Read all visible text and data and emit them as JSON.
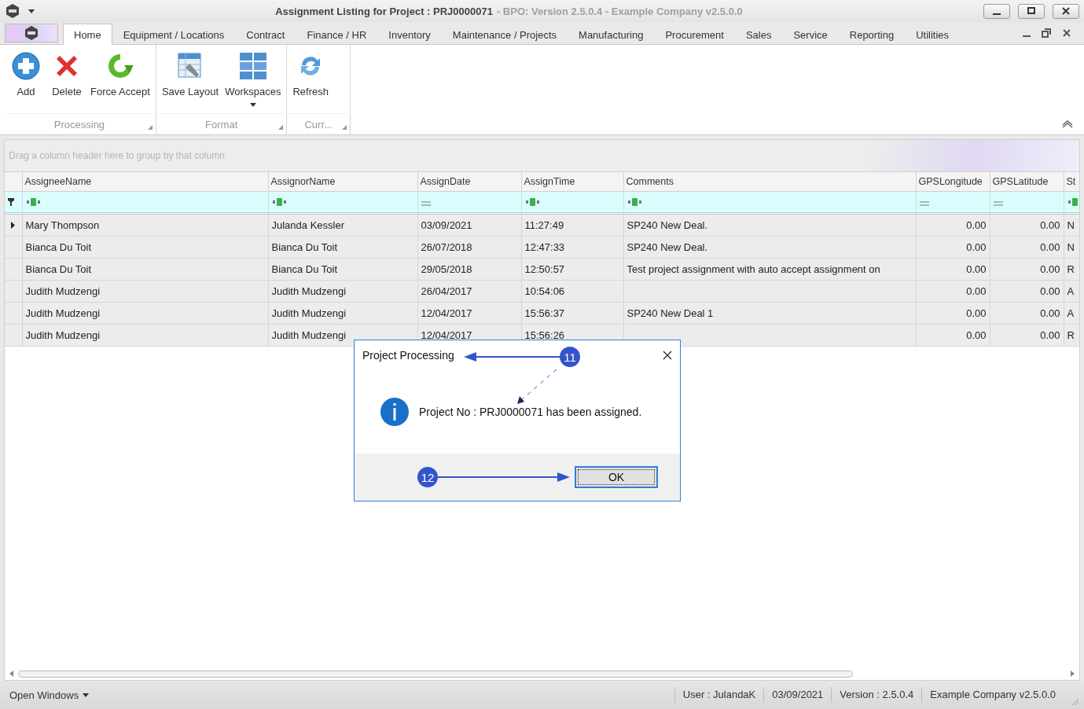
{
  "window": {
    "title": "Assignment Listing for Project : PRJ0000071",
    "subtitle": "- BPO: Version 2.5.0.4 - Example Company v2.5.0.0"
  },
  "ribbon_tabs": [
    {
      "label": "Home",
      "selected": true
    },
    {
      "label": "Equipment / Locations",
      "selected": false
    },
    {
      "label": "Contract",
      "selected": false
    },
    {
      "label": "Finance / HR",
      "selected": false
    },
    {
      "label": "Inventory",
      "selected": false
    },
    {
      "label": "Maintenance / Projects",
      "selected": false
    },
    {
      "label": "Manufacturing",
      "selected": false
    },
    {
      "label": "Procurement",
      "selected": false
    },
    {
      "label": "Sales",
      "selected": false
    },
    {
      "label": "Service",
      "selected": false
    },
    {
      "label": "Reporting",
      "selected": false
    },
    {
      "label": "Utilities",
      "selected": false
    }
  ],
  "ribbon_groups": [
    {
      "label": "Processing",
      "buttons": [
        {
          "label": "Add",
          "kind": "add"
        },
        {
          "label": "Delete",
          "kind": "delete"
        },
        {
          "label": "Force Accept",
          "kind": "accept"
        }
      ]
    },
    {
      "label": "Format",
      "buttons": [
        {
          "label": "Save Layout",
          "kind": "layout"
        },
        {
          "label": "Workspaces",
          "kind": "workspaces",
          "dropdown": true
        }
      ]
    },
    {
      "label": "Curr...",
      "buttons": [
        {
          "label": "Refresh",
          "kind": "refresh"
        }
      ]
    }
  ],
  "group_panel": {
    "placeholder": "Drag a column header here to group by that column"
  },
  "table": {
    "columns": [
      {
        "label": "AssigneeName",
        "kind": "text"
      },
      {
        "label": "AssignorName",
        "kind": "text"
      },
      {
        "label": "AssignDate",
        "kind": "date"
      },
      {
        "label": "AssignTime",
        "kind": "text"
      },
      {
        "label": "Comments",
        "kind": "text"
      },
      {
        "label": "GPSLongitude",
        "kind": "number"
      },
      {
        "label": "GPSLatitude",
        "kind": "number"
      },
      {
        "label": "St",
        "kind": "text"
      }
    ],
    "rows": [
      {
        "selected": true,
        "cells": [
          "Mary Thompson",
          "Julanda Kessler",
          "03/09/2021",
          "11:27:49",
          "SP240 New Deal.",
          "0.00",
          "0.00",
          "N"
        ]
      },
      {
        "selected": false,
        "cells": [
          "Bianca Du Toit",
          "Bianca Du Toit",
          "26/07/2018",
          "12:47:33",
          "SP240 New Deal.",
          "0.00",
          "0.00",
          "N"
        ]
      },
      {
        "selected": false,
        "cells": [
          "Bianca Du Toit",
          "Bianca Du Toit",
          "29/05/2018",
          "12:50:57",
          "Test project assignment with auto accept assignment on",
          "0.00",
          "0.00",
          "R"
        ]
      },
      {
        "selected": false,
        "cells": [
          "Judith Mudzengi",
          "Judith Mudzengi",
          "26/04/2017",
          "10:54:06",
          "",
          "0.00",
          "0.00",
          "A"
        ]
      },
      {
        "selected": false,
        "cells": [
          "Judith Mudzengi",
          "Judith Mudzengi",
          "12/04/2017",
          "15:56:37",
          "SP240 New Deal 1",
          "0.00",
          "0.00",
          "A"
        ]
      },
      {
        "selected": false,
        "cells": [
          "Judith Mudzengi",
          "Judith Mudzengi",
          "12/04/2017",
          "15:56:26",
          "",
          "0.00",
          "0.00",
          "R"
        ]
      }
    ]
  },
  "dialog": {
    "title": "Project Processing",
    "message": "Project No : PRJ0000071 has been assigned.",
    "button": "OK"
  },
  "callouts": [
    "11",
    "12"
  ],
  "status_bar": {
    "open_windows": "Open Windows",
    "items": [
      "User : JulandaK",
      "03/09/2021",
      "Version : 2.5.0.4",
      "Example Company v2.5.0.0"
    ]
  }
}
